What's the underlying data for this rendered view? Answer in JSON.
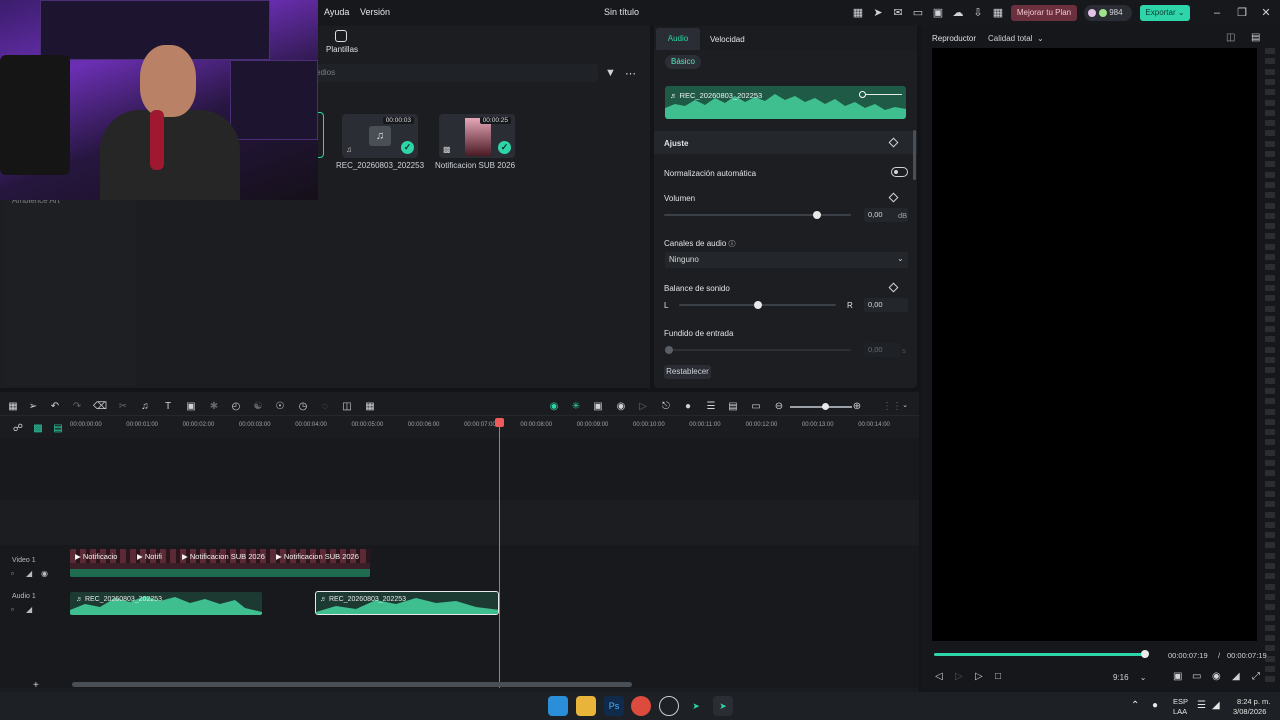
{
  "menu": {
    "help": "Ayuda",
    "version": "Versión"
  },
  "document": {
    "title": "Sin título"
  },
  "header": {
    "upgrade_label": "Mejorar tu Plan",
    "credits": "984",
    "export_label": "Exportar"
  },
  "media": {
    "templates_tab": "Plantillas",
    "search_placeholder": "edios",
    "ambience_label": "Ambience Art",
    "items": [
      {
        "name": "REC_20260803_202253",
        "duration": "00:00:03"
      },
      {
        "name": "Notificacion SUB 2026",
        "duration": "00:00:25"
      }
    ]
  },
  "properties": {
    "tabs": [
      "Audio",
      "Velocidad"
    ],
    "subtab": "Básico",
    "clip_name": "REC_20260803_202253",
    "section_title": "Ajuste",
    "auto_normalization": "Normalización automática",
    "volume": {
      "label": "Volumen",
      "value": "0,00",
      "unit": "dB",
      "level": 0.82
    },
    "channels": {
      "label": "Canales de audio",
      "value": "Ninguno"
    },
    "balance": {
      "label": "Balance de sonido",
      "left": "L",
      "right": "R",
      "value": "0,00",
      "level": 0.5
    },
    "fade_in": {
      "label": "Fundido de entrada",
      "value": "0,00",
      "unit": "s"
    },
    "reset_label": "Restablecer"
  },
  "player": {
    "label": "Reproductor",
    "quality": "Calidad total",
    "current_time": "00:00:07:19",
    "total_time": "00:00:07:19",
    "separator": "/",
    "ratio": "9:16",
    "progress": 1.0
  },
  "timeline": {
    "ruler_ticks": [
      "00:00:00:00",
      "00:00:01:00",
      "00:00:02:00",
      "00:00:03:00",
      "00:00:04:00",
      "00:00:05:00",
      "00:00:06:00",
      "00:00:07:00",
      "00:00:08:00",
      "00:00:09:00",
      "00:00:10:00",
      "00:00:11:00",
      "00:00:12:00",
      "00:00:13:00",
      "00:00:14:00"
    ],
    "tracks": {
      "video": "Video 1",
      "audio": "Audio 1"
    },
    "video_clips": [
      "Notificacio",
      "Notifi",
      "Notificacion SUB 2026",
      "Notificacion SUB 2026"
    ],
    "audio_clips": [
      "REC_20260803_202253",
      "REC_20260803_202253"
    ]
  },
  "taskbar": {
    "lang": "ESP",
    "layout": "LAA",
    "time": "8:24 p. m.",
    "date": "3/08/2026"
  },
  "colors": {
    "accent": "#2ed5a8",
    "playhead": "#f05a5a",
    "upgrade": "#6b2f3d"
  }
}
